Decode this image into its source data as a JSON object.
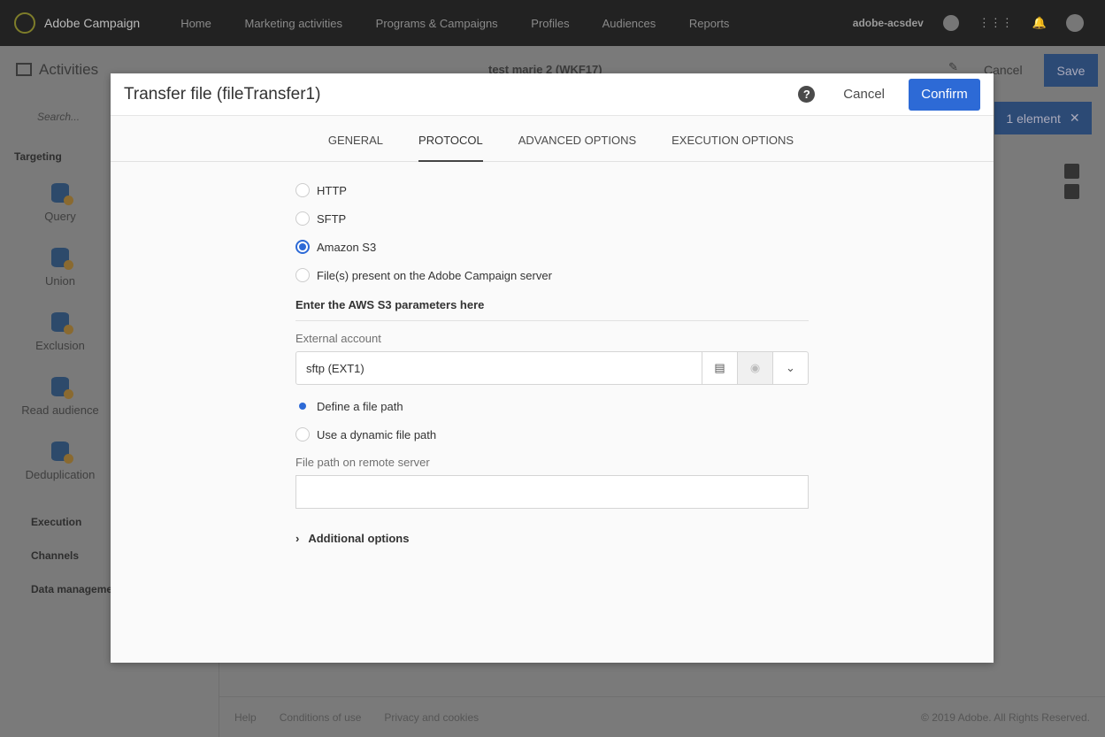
{
  "topbar": {
    "brand": "Adobe Campaign",
    "nav": [
      "Home",
      "Marketing activities",
      "Programs & Campaigns",
      "Profiles",
      "Audiences",
      "Reports"
    ],
    "user": "adobe-acsdev"
  },
  "subbar": {
    "activities": "Activities",
    "workflow": "test marie 2 (WKF17)",
    "cancel": "Cancel",
    "save": "Save",
    "selection": "1 element"
  },
  "sidebar": {
    "search_placeholder": "Search...",
    "sections": [
      "Targeting",
      "Execution",
      "Channels",
      "Data management"
    ],
    "activities": [
      "Query",
      "Union",
      "Exclusion",
      "Read audience",
      "Deduplication"
    ]
  },
  "footer": {
    "links": [
      "Help",
      "Conditions of use",
      "Privacy and cookies"
    ],
    "copyright": "© 2019 Adobe. All Rights Reserved."
  },
  "modal": {
    "title": "Transfer file (fileTransfer1)",
    "cancel": "Cancel",
    "confirm": "Confirm",
    "tabs": [
      "GENERAL",
      "PROTOCOL",
      "ADVANCED OPTIONS",
      "EXECUTION OPTIONS"
    ],
    "protocols": [
      "HTTP",
      "SFTP",
      "Amazon S3",
      "File(s) present on the Adobe Campaign server"
    ],
    "section_heading": "Enter the AWS S3 parameters here",
    "external_account_label": "External account",
    "external_account_value": "sftp (EXT1)",
    "path_options": [
      "Define a file path",
      "Use a dynamic file path"
    ],
    "file_path_label": "File path on remote server",
    "file_path_value": "",
    "additional_options": "Additional options"
  }
}
